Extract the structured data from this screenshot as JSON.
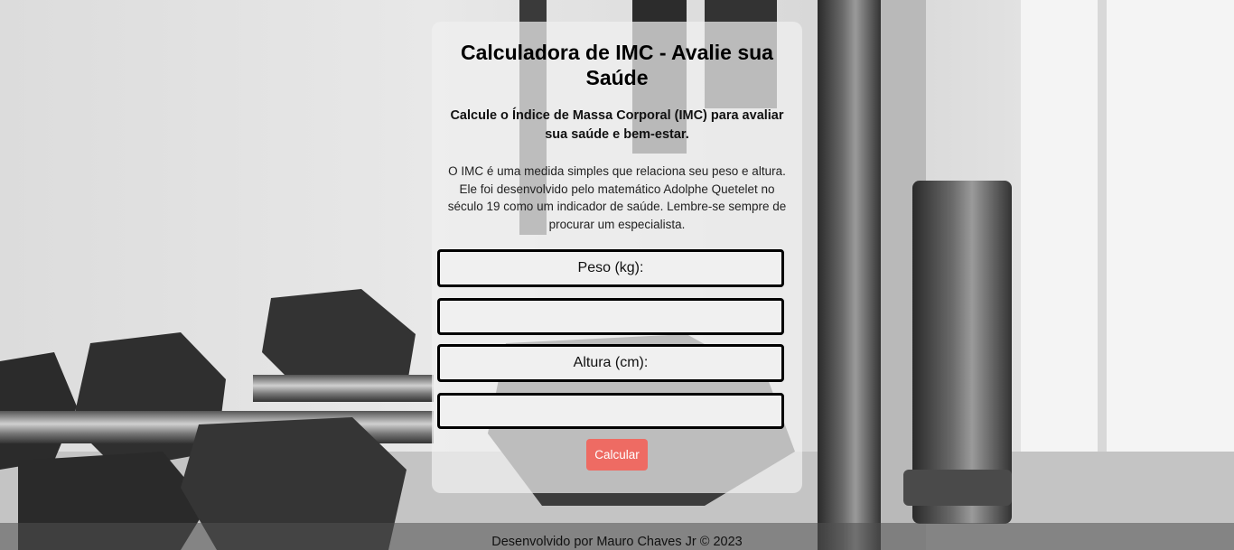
{
  "card": {
    "title": "Calculadora de IMC - Avalie sua Saúde",
    "subtitle": "Calcule o Índice de Massa Corporal (IMC) para avaliar sua saúde e bem-estar.",
    "description": "O IMC é uma medida simples que relaciona seu peso e altura. Ele foi desenvolvido pelo matemático Adolphe Quetelet no século 19 como um indicador de saúde. Lembre-se sempre de procurar um especialista."
  },
  "form": {
    "weight_label": "Peso (kg):",
    "weight_value": "",
    "height_label": "Altura (cm):",
    "height_value": "",
    "calculate_label": "Calcular"
  },
  "footer": {
    "text": "Desenvolvido por Mauro Chaves Jr © 2023"
  },
  "colors": {
    "button": "#ee6b63",
    "field_border": "#000000"
  }
}
